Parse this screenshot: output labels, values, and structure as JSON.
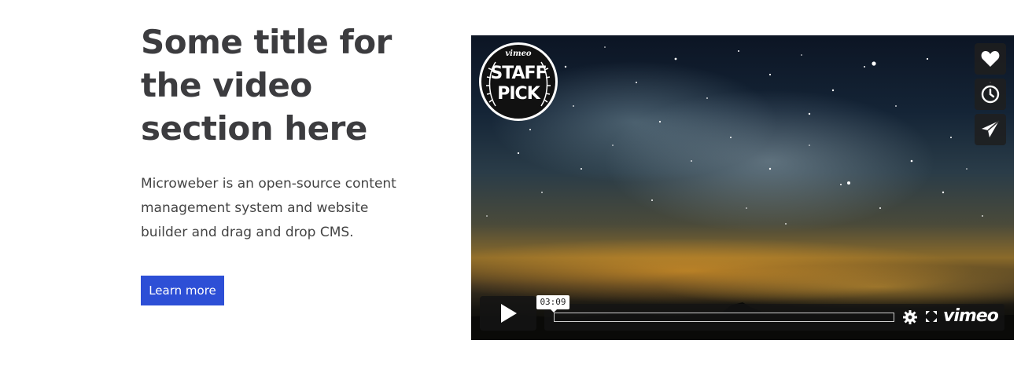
{
  "section": {
    "title": "Some title for the video section here",
    "description": "Microweber is an open-source content management system and website builder and drag and drop CMS.",
    "button_label": "Learn more",
    "button_color": "#2d4fd6"
  },
  "video": {
    "badge": {
      "brand": "vimeo",
      "line1": "STAFF",
      "line2": "PICK"
    },
    "side_actions": [
      {
        "icon": "heart-icon"
      },
      {
        "icon": "clock-icon"
      },
      {
        "icon": "send-icon"
      }
    ],
    "duration": "03:09",
    "logo_text": "vimeo",
    "controls": {
      "play_icon": "play-icon",
      "settings_icon": "gear-icon",
      "fullscreen_icon": "fullscreen-icon"
    }
  }
}
